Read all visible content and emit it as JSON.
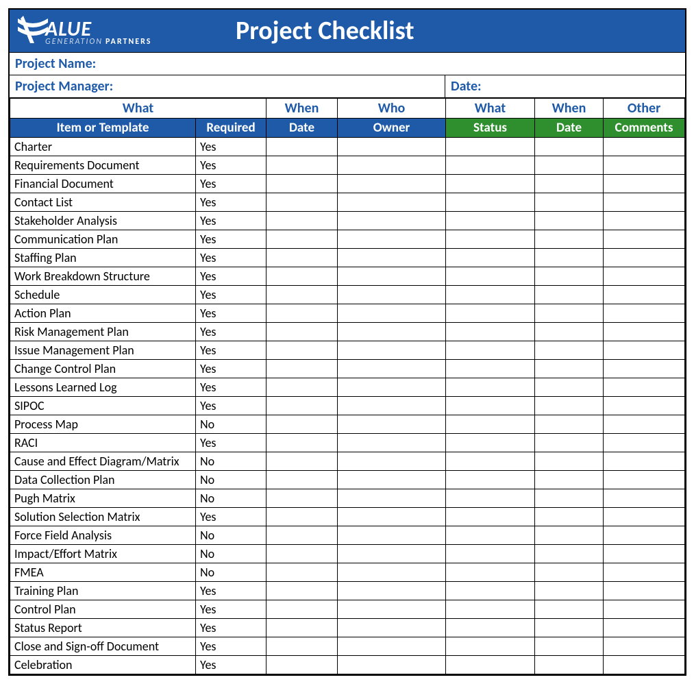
{
  "brand": {
    "top": "ALUE",
    "bottom1": "GENERATION",
    "bottom2": "PARTNERS"
  },
  "title": "Project Checklist",
  "meta": {
    "project_name_label": "Project Name:",
    "project_manager_label": "Project Manager:",
    "date_label": "Date:"
  },
  "group_headers": {
    "what1": "What",
    "when1": "When",
    "who": "Who",
    "what2": "What",
    "when2": "When",
    "other": "Other"
  },
  "col_headers": {
    "item": "Item or Template",
    "required": "Required",
    "date1": "Date",
    "owner": "Owner",
    "status": "Status",
    "date2": "Date",
    "comments": "Comments"
  },
  "rows": [
    {
      "item": "Charter",
      "required": "Yes",
      "date1": "",
      "owner": "",
      "status": "",
      "date2": "",
      "comments": ""
    },
    {
      "item": "Requirements Document",
      "required": "Yes",
      "date1": "",
      "owner": "",
      "status": "",
      "date2": "",
      "comments": ""
    },
    {
      "item": "Financial Document",
      "required": "Yes",
      "date1": "",
      "owner": "",
      "status": "",
      "date2": "",
      "comments": ""
    },
    {
      "item": "Contact List",
      "required": "Yes",
      "date1": "",
      "owner": "",
      "status": "",
      "date2": "",
      "comments": ""
    },
    {
      "item": "Stakeholder Analysis",
      "required": "Yes",
      "date1": "",
      "owner": "",
      "status": "",
      "date2": "",
      "comments": ""
    },
    {
      "item": "Communication Plan",
      "required": "Yes",
      "date1": "",
      "owner": "",
      "status": "",
      "date2": "",
      "comments": ""
    },
    {
      "item": "Staffing Plan",
      "required": "Yes",
      "date1": "",
      "owner": "",
      "status": "",
      "date2": "",
      "comments": ""
    },
    {
      "item": "Work Breakdown Structure",
      "required": "Yes",
      "date1": "",
      "owner": "",
      "status": "",
      "date2": "",
      "comments": ""
    },
    {
      "item": "Schedule",
      "required": "Yes",
      "date1": "",
      "owner": "",
      "status": "",
      "date2": "",
      "comments": ""
    },
    {
      "item": "Action Plan",
      "required": "Yes",
      "date1": "",
      "owner": "",
      "status": "",
      "date2": "",
      "comments": ""
    },
    {
      "item": "Risk Management Plan",
      "required": "Yes",
      "date1": "",
      "owner": "",
      "status": "",
      "date2": "",
      "comments": ""
    },
    {
      "item": "Issue Management Plan",
      "required": "Yes",
      "date1": "",
      "owner": "",
      "status": "",
      "date2": "",
      "comments": ""
    },
    {
      "item": "Change Control Plan",
      "required": "Yes",
      "date1": "",
      "owner": "",
      "status": "",
      "date2": "",
      "comments": ""
    },
    {
      "item": "Lessons Learned Log",
      "required": "Yes",
      "date1": "",
      "owner": "",
      "status": "",
      "date2": "",
      "comments": ""
    },
    {
      "item": "SIPOC",
      "required": "Yes",
      "date1": "",
      "owner": "",
      "status": "",
      "date2": "",
      "comments": ""
    },
    {
      "item": "Process Map",
      "required": "No",
      "date1": "",
      "owner": "",
      "status": "",
      "date2": "",
      "comments": ""
    },
    {
      "item": "RACI",
      "required": "Yes",
      "date1": "",
      "owner": "",
      "status": "",
      "date2": "",
      "comments": ""
    },
    {
      "item": "Cause and Effect Diagram/Matrix",
      "required": "No",
      "date1": "",
      "owner": "",
      "status": "",
      "date2": "",
      "comments": ""
    },
    {
      "item": "Data Collection Plan",
      "required": "No",
      "date1": "",
      "owner": "",
      "status": "",
      "date2": "",
      "comments": ""
    },
    {
      "item": "Pugh Matrix",
      "required": "No",
      "date1": "",
      "owner": "",
      "status": "",
      "date2": "",
      "comments": ""
    },
    {
      "item": "Solution Selection Matrix",
      "required": "Yes",
      "date1": "",
      "owner": "",
      "status": "",
      "date2": "",
      "comments": ""
    },
    {
      "item": "Force Field Analysis",
      "required": "No",
      "date1": "",
      "owner": "",
      "status": "",
      "date2": "",
      "comments": ""
    },
    {
      "item": "Impact/Effort Matrix",
      "required": "No",
      "date1": "",
      "owner": "",
      "status": "",
      "date2": "",
      "comments": ""
    },
    {
      "item": "FMEA",
      "required": "No",
      "date1": "",
      "owner": "",
      "status": "",
      "date2": "",
      "comments": ""
    },
    {
      "item": "Training Plan",
      "required": "Yes",
      "date1": "",
      "owner": "",
      "status": "",
      "date2": "",
      "comments": ""
    },
    {
      "item": "Control Plan",
      "required": "Yes",
      "date1": "",
      "owner": "",
      "status": "",
      "date2": "",
      "comments": ""
    },
    {
      "item": "Status Report",
      "required": "Yes",
      "date1": "",
      "owner": "",
      "status": "",
      "date2": "",
      "comments": ""
    },
    {
      "item": "Close and Sign-off Document",
      "required": "Yes",
      "date1": "",
      "owner": "",
      "status": "",
      "date2": "",
      "comments": ""
    },
    {
      "item": "Celebration",
      "required": "Yes",
      "date1": "",
      "owner": "",
      "status": "",
      "date2": "",
      "comments": ""
    }
  ]
}
